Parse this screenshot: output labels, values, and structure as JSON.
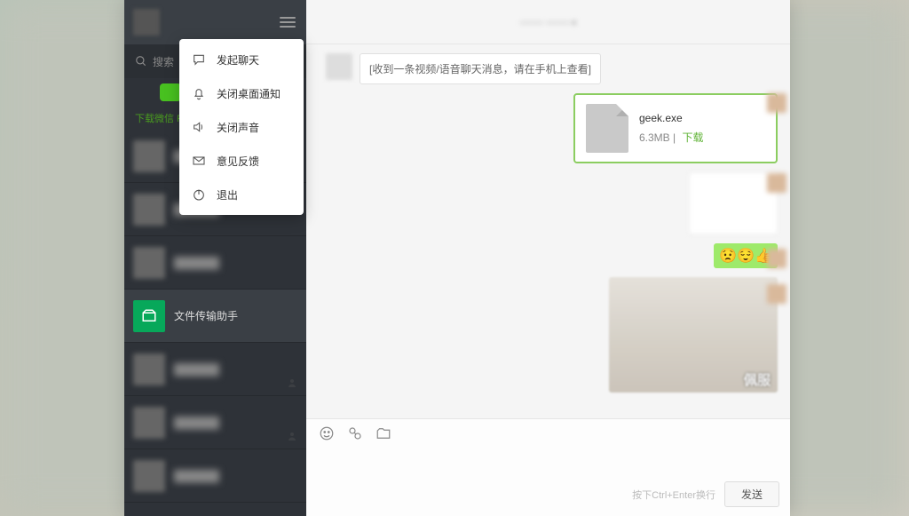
{
  "sidebar": {
    "search_placeholder": "搜索",
    "download_label": "下载微信 F",
    "file_helper_label": "文件传输助手"
  },
  "menu": {
    "items": [
      {
        "label": "发起聊天",
        "icon": "chat-bubble-icon"
      },
      {
        "label": "关闭桌面通知",
        "icon": "bell-icon"
      },
      {
        "label": "关闭声音",
        "icon": "speaker-icon"
      },
      {
        "label": "意见反馈",
        "icon": "mail-icon"
      },
      {
        "label": "退出",
        "icon": "power-icon"
      }
    ]
  },
  "chat": {
    "header_title": "—— ——",
    "system_msg": "[收到一条视频/语音聊天消息，请在手机上查看]",
    "file": {
      "name": "geek.exe",
      "size": "6.3MB",
      "download_label": "下载"
    },
    "emoji_row": "😟😌👍",
    "gif_caption": "佩服",
    "send_hint": "按下Ctrl+Enter换行",
    "send_label": "发送"
  }
}
